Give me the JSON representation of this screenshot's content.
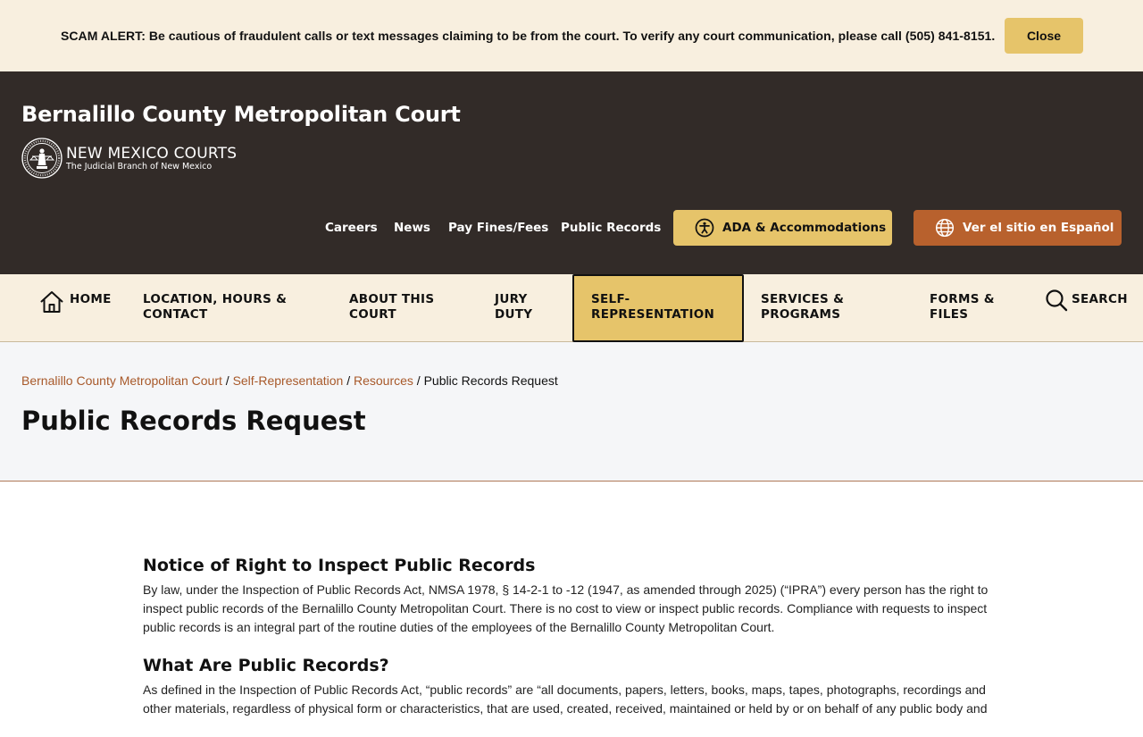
{
  "alert": {
    "text": "SCAM ALERT: Be cautious of fraudulent calls or text messages claiming to be from the court. To verify any court communication, please call (505) 841-8151.",
    "close_label": "Close"
  },
  "header": {
    "site_title": "Bernalillo County Metropolitan Court",
    "logo": {
      "name": "NEW MEXICO COURTS",
      "tagline": "The Judicial Branch of New Mexico",
      "seal_text": "SUPREME COURT · STATE OF NEW MEXICO"
    },
    "utility_links": [
      "Careers",
      "News",
      "Pay Fines/Fees",
      "Public Records"
    ],
    "ada_button": {
      "label": "ADA & Accommodations",
      "icon": "accessibility-icon"
    },
    "spanish_button": {
      "label": "Ver el sitio en Español",
      "icon": "globe-icon"
    }
  },
  "nav": {
    "home": {
      "label": "HOME",
      "icon": "home-icon"
    },
    "items": [
      {
        "line1": "LOCATION, HOURS &",
        "line2": "CONTACT"
      },
      {
        "line1": "ABOUT THIS",
        "line2": "COURT"
      },
      {
        "line1": "JURY",
        "line2": "DUTY"
      },
      {
        "line1": "SELF-",
        "line2": "REPRESENTATION",
        "active": true
      },
      {
        "line1": "SERVICES &",
        "line2": "PROGRAMS"
      },
      {
        "line1": "FORMS &",
        "line2": "FILES"
      }
    ],
    "search": {
      "label": "SEARCH",
      "icon": "search-icon"
    }
  },
  "breadcrumb": {
    "items": [
      "Bernalillo County Metropolitan Court",
      "Self-Representation",
      "Resources"
    ],
    "separator": "/",
    "current": "Public Records Request"
  },
  "page_title": "Public Records Request",
  "sections": [
    {
      "heading": "Notice of Right to Inspect Public Records",
      "body": "By law, under the Inspection of Public Records Act, NMSA 1978, § 14-2-1 to -12 (1947, as amended through 2025) (“IPRA”) every person has the right to inspect public records of the Bernalillo County Metropolitan Court. There is no cost to view or inspect public records. Compliance with requests to inspect public records is an integral part of the routine duties of the employees of the Bernalillo County Metropolitan Court."
    },
    {
      "heading": "What Are Public Records?",
      "body": "As defined in the Inspection of Public Records Act, “public records” are “all documents, papers, letters, books, maps, tapes, photographs, recordings and other materials, regardless of physical form or characteristics, that are used, created, received, maintained or held by or on behalf of any public body and"
    }
  ],
  "colors": {
    "alert_bg": "#f8efdf",
    "header_bg": "#322b28",
    "gold": "#e6c46a",
    "rust": "#b8612d",
    "link": "#a8592a",
    "title_band_bg": "#f5f6f8"
  }
}
